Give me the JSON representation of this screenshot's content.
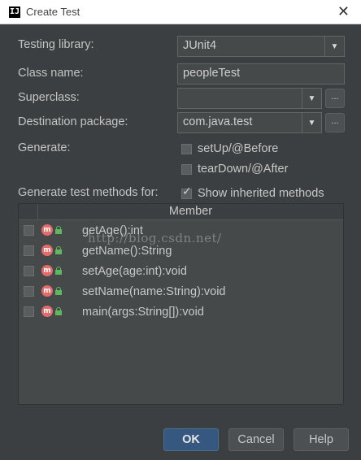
{
  "window": {
    "title": "Create Test",
    "close_glyph": "✕"
  },
  "form": {
    "testing_library": {
      "label": "Testing library:",
      "value": "JUnit4"
    },
    "class_name": {
      "label": "Class name:",
      "value": "peopleTest"
    },
    "superclass": {
      "label": "Superclass:",
      "value": ""
    },
    "destination_package": {
      "label": "Destination package:",
      "value": "com.java.test"
    },
    "generate_label": "Generate:",
    "setup": {
      "label": "setUp/@Before",
      "checked": false
    },
    "teardown": {
      "label": "tearDown/@After",
      "checked": false
    },
    "generate_methods_label": "Generate test methods for:",
    "show_inherited": {
      "label": "Show inherited methods",
      "checked": true
    },
    "browse_glyph": "..."
  },
  "table": {
    "header": "Member",
    "rows": [
      {
        "method": "getAge():int",
        "checked": false,
        "icon": "method-icon"
      },
      {
        "method": "getName():String",
        "checked": false,
        "icon": "method-icon"
      },
      {
        "method": "setAge(age:int):void",
        "checked": false,
        "icon": "method-icon"
      },
      {
        "method": "setName(name:String):void",
        "checked": false,
        "icon": "method-icon"
      },
      {
        "method": "main(args:String[]):void",
        "checked": false,
        "icon": "method-icon"
      }
    ],
    "method_badge": "m"
  },
  "watermark": "http://blog.csdn.net/",
  "buttons": {
    "ok": "OK",
    "cancel": "Cancel",
    "help": "Help"
  },
  "colors": {
    "background": "#3c3f41",
    "primary_button": "#365880",
    "method_badge": "#e36b6b",
    "lock": "#5fb85f"
  }
}
